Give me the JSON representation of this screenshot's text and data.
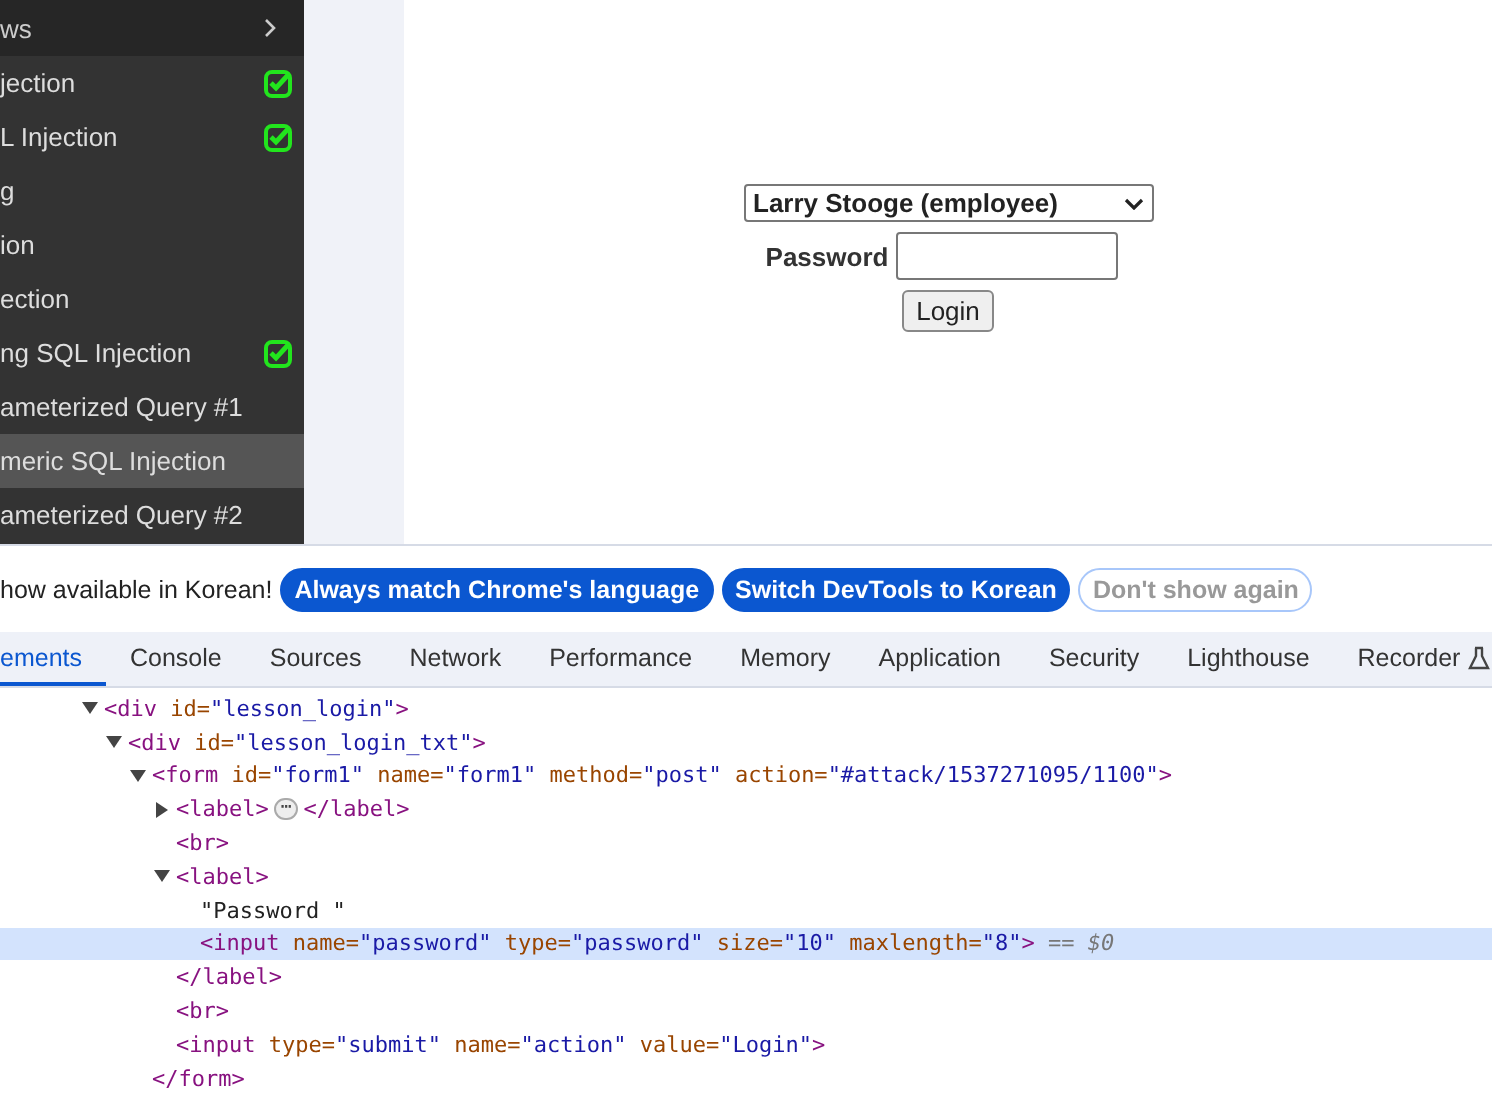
{
  "sidebar": {
    "header": {
      "label": "ws"
    },
    "items": [
      {
        "label": "jection",
        "completed": true,
        "selected": false
      },
      {
        "label": "L Injection",
        "completed": true,
        "selected": false
      },
      {
        "label": "g",
        "completed": false,
        "selected": false
      },
      {
        "label": "ion",
        "completed": false,
        "selected": false
      },
      {
        "label": "ection",
        "completed": false,
        "selected": false
      },
      {
        "label": "ng SQL Injection",
        "completed": true,
        "selected": false
      },
      {
        "label": "ameterized Query #1",
        "completed": false,
        "selected": false
      },
      {
        "label": "meric SQL Injection",
        "completed": false,
        "selected": true
      },
      {
        "label": "ameterized Query #2",
        "completed": false,
        "selected": false
      }
    ]
  },
  "login_form": {
    "user_select": {
      "value": "Larry Stooge (employee)"
    },
    "password_label": "Password",
    "login_button": "Login"
  },
  "devtools": {
    "banner": {
      "message": "how available in Korean!",
      "buttons": [
        {
          "label": "Always match Chrome's language",
          "kind": "primary"
        },
        {
          "label": "Switch DevTools to Korean",
          "kind": "primary"
        },
        {
          "label": "Don't show again",
          "kind": "outline"
        }
      ]
    },
    "tabs": [
      {
        "label": "ements",
        "selected": true
      },
      {
        "label": "Console",
        "selected": false
      },
      {
        "label": "Sources",
        "selected": false
      },
      {
        "label": "Network",
        "selected": false
      },
      {
        "label": "Performance",
        "selected": false
      },
      {
        "label": "Memory",
        "selected": false
      },
      {
        "label": "Application",
        "selected": false
      },
      {
        "label": "Security",
        "selected": false
      },
      {
        "label": "Lighthouse",
        "selected": false
      },
      {
        "label": "Recorder",
        "selected": false,
        "experimental": true
      }
    ],
    "dom_tree": [
      {
        "expanded": true,
        "selected": false,
        "open": [
          {
            "kind": "tag",
            "text": "<div"
          },
          {
            "kind": "attr",
            "text": " id="
          },
          {
            "kind": "value",
            "text": "\"lesson_login\""
          },
          {
            "kind": "tag",
            "text": ">"
          }
        ],
        "children": [
          {
            "expanded": true,
            "selected": false,
            "open": [
              {
                "kind": "tag",
                "text": "<div"
              },
              {
                "kind": "attr",
                "text": " id="
              },
              {
                "kind": "value",
                "text": "\"lesson_login_txt\""
              },
              {
                "kind": "tag",
                "text": ">"
              }
            ],
            "children": [
              {
                "expanded": true,
                "selected": false,
                "open": [
                  {
                    "kind": "tag",
                    "text": "<form"
                  },
                  {
                    "kind": "attr",
                    "text": " id="
                  },
                  {
                    "kind": "value",
                    "text": "\"form1\""
                  },
                  {
                    "kind": "attr",
                    "text": " name="
                  },
                  {
                    "kind": "value",
                    "text": "\"form1\""
                  },
                  {
                    "kind": "attr",
                    "text": " method="
                  },
                  {
                    "kind": "value",
                    "text": "\"post\""
                  },
                  {
                    "kind": "attr",
                    "text": " action="
                  },
                  {
                    "kind": "value",
                    "text": "\"#attack/1537271095/1100\""
                  },
                  {
                    "kind": "tag",
                    "text": ">"
                  }
                ],
                "close": [
                  {
                    "kind": "tag",
                    "text": "</form>"
                  }
                ],
                "children": [
                  {
                    "expanded": false,
                    "selected": false,
                    "open": [
                      {
                        "kind": "tag",
                        "text": "<label>"
                      },
                      {
                        "kind": "badge",
                        "text": "⋯"
                      },
                      {
                        "kind": "tag",
                        "text": "</label>"
                      }
                    ]
                  },
                  {
                    "selected": false,
                    "open": [
                      {
                        "kind": "tag",
                        "text": "<br>"
                      }
                    ]
                  },
                  {
                    "expanded": true,
                    "selected": false,
                    "open": [
                      {
                        "kind": "tag",
                        "text": "<label>"
                      }
                    ],
                    "close": [
                      {
                        "kind": "tag",
                        "text": "</label>"
                      }
                    ],
                    "children": [
                      {
                        "selected": false,
                        "open": [
                          {
                            "kind": "text",
                            "text": "\"Password \""
                          }
                        ]
                      },
                      {
                        "selected": true,
                        "open": [
                          {
                            "kind": "tag",
                            "text": "<input"
                          },
                          {
                            "kind": "attr",
                            "text": " name="
                          },
                          {
                            "kind": "value",
                            "text": "\"password\""
                          },
                          {
                            "kind": "attr",
                            "text": " type="
                          },
                          {
                            "kind": "value",
                            "text": "\"password\""
                          },
                          {
                            "kind": "attr",
                            "text": " size="
                          },
                          {
                            "kind": "value",
                            "text": "\"10\""
                          },
                          {
                            "kind": "attr",
                            "text": " maxlength="
                          },
                          {
                            "kind": "value",
                            "text": "\"8\""
                          },
                          {
                            "kind": "tag",
                            "text": ">"
                          },
                          {
                            "kind": "note",
                            "text": " == $0"
                          }
                        ]
                      }
                    ]
                  },
                  {
                    "selected": false,
                    "open": [
                      {
                        "kind": "tag",
                        "text": "<br>"
                      }
                    ]
                  },
                  {
                    "selected": false,
                    "open": [
                      {
                        "kind": "tag",
                        "text": "<input"
                      },
                      {
                        "kind": "attr",
                        "text": " type="
                      },
                      {
                        "kind": "value",
                        "text": "\"submit\""
                      },
                      {
                        "kind": "attr",
                        "text": " name="
                      },
                      {
                        "kind": "value",
                        "text": "\"action\""
                      },
                      {
                        "kind": "attr",
                        "text": " value="
                      },
                      {
                        "kind": "value",
                        "text": "\"Login\""
                      },
                      {
                        "kind": "tag",
                        "text": ">"
                      }
                    ]
                  }
                ]
              }
            ]
          }
        ]
      }
    ]
  }
}
